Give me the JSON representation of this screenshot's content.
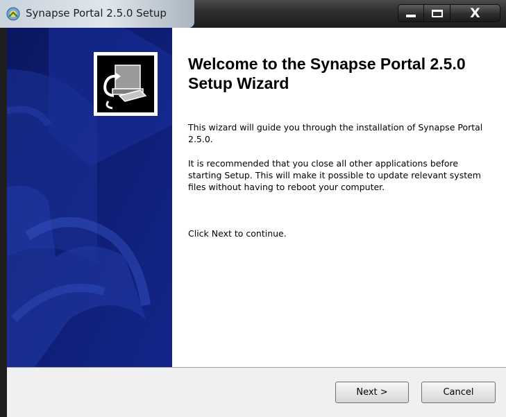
{
  "window": {
    "title": "Synapse Portal 2.5.0 Setup",
    "icon": "app-installer-icon"
  },
  "caption_buttons": {
    "minimize_icon": "minimize-icon",
    "maximize_icon": "maximize-icon",
    "close_label": "X"
  },
  "banner": {
    "logo_icon": "computer-install-icon",
    "background_color": "#0c1d70"
  },
  "welcome": {
    "heading": "Welcome to the Synapse Portal 2.5.0 Setup Wizard",
    "paragraph_1": "This wizard will guide you through the installation of Synapse Portal 2.5.0.",
    "paragraph_2": "It is recommended that you close all other applications before starting Setup. This will make it possible to update relevant system files without having to reboot your computer.",
    "paragraph_3": "Click Next to continue."
  },
  "buttons": {
    "next_label": "Next >",
    "cancel_label": "Cancel"
  }
}
